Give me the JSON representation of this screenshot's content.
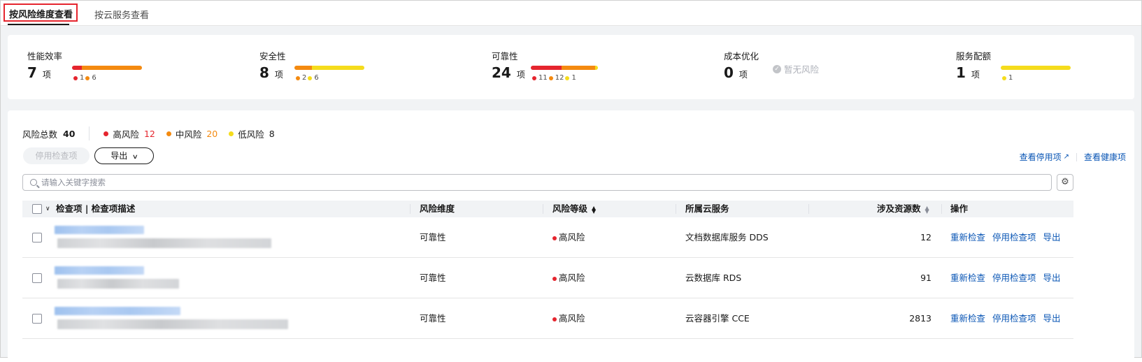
{
  "tabs": [
    {
      "label": "按风险维度查看",
      "active": true
    },
    {
      "label": "按云服务查看",
      "active": false
    }
  ],
  "colors": {
    "high": "#e5252e",
    "medium": "#f48a10",
    "low": "#f5dc1c",
    "link": "#0a56b5"
  },
  "dimensions": [
    {
      "name": "性能效率",
      "count": "7",
      "unit": "项",
      "high": 1,
      "medium": 6,
      "low": 0,
      "legend": [
        {
          "level": "high",
          "value": "1"
        },
        {
          "level": "medium",
          "value": "6"
        }
      ]
    },
    {
      "name": "安全性",
      "count": "8",
      "unit": "项",
      "high": 0,
      "medium": 2,
      "low": 6,
      "legend": [
        {
          "level": "medium",
          "value": "2"
        },
        {
          "level": "low",
          "value": "6"
        }
      ]
    },
    {
      "name": "可靠性",
      "count": "24",
      "unit": "项",
      "high": 11,
      "medium": 12,
      "low": 1,
      "legend": [
        {
          "level": "high",
          "value": "11"
        },
        {
          "level": "medium",
          "value": "12"
        },
        {
          "level": "low",
          "value": "1"
        }
      ]
    },
    {
      "name": "成本优化",
      "count": "0",
      "unit": "项",
      "high": 0,
      "medium": 0,
      "low": 0,
      "no_risk_text": "暂无风险",
      "legend": []
    },
    {
      "name": "服务配额",
      "count": "1",
      "unit": "项",
      "high": 0,
      "medium": 0,
      "low": 1,
      "legend": [
        {
          "level": "low",
          "value": "1"
        }
      ]
    }
  ],
  "stats": {
    "total_label": "风险总数",
    "total_value": "40",
    "high_label": "高风险",
    "high_value": "12",
    "medium_label": "中风险",
    "medium_value": "20",
    "low_label": "低风险",
    "low_value": "8"
  },
  "toolbar": {
    "disable_label": "停用检查项",
    "export_label": "导出",
    "view_disabled_label": "查看停用项",
    "view_healthy_label": "查看健康项"
  },
  "search": {
    "placeholder": "请输入关键字搜索"
  },
  "table": {
    "headers": {
      "item": "检查项 | 检查项描述",
      "dimension": "风险维度",
      "level": "风险等级",
      "service": "所属云服务",
      "resources": "涉及资源数",
      "ops": "操作"
    },
    "rows": [
      {
        "dimension": "可靠性",
        "level": "高风险",
        "service": "文档数据库服务 DDS",
        "resources": "12"
      },
      {
        "dimension": "可靠性",
        "level": "高风险",
        "service": "云数据库 RDS",
        "resources": "91"
      },
      {
        "dimension": "可靠性",
        "level": "高风险",
        "service": "云容器引擎 CCE",
        "resources": "2813"
      }
    ],
    "row_ops": {
      "recheck": "重新检查",
      "disable": "停用检查项",
      "export": "导出"
    }
  }
}
